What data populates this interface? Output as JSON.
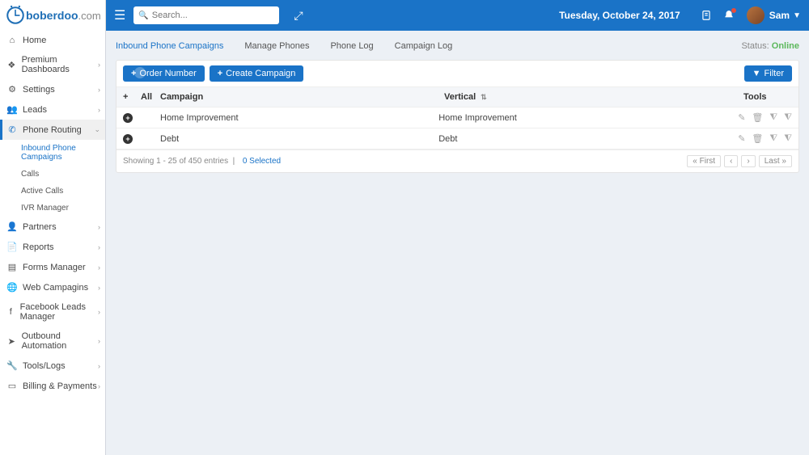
{
  "header": {
    "logo_main": "boberdoo",
    "logo_ext": ".com",
    "search_placeholder": "Search...",
    "date": "Tuesday, October 24, 2017",
    "user_name": "Sam"
  },
  "sidebar": {
    "items": [
      {
        "label": "Home",
        "icon": "home",
        "expandable": false
      },
      {
        "label": "Premium Dashboards",
        "icon": "dashboard",
        "expandable": true
      },
      {
        "label": "Settings",
        "icon": "gear",
        "expandable": true
      },
      {
        "label": "Leads",
        "icon": "users",
        "expandable": true
      },
      {
        "label": "Phone Routing",
        "icon": "phone",
        "expandable": true,
        "active": true
      },
      {
        "label": "Partners",
        "icon": "user",
        "expandable": true
      },
      {
        "label": "Reports",
        "icon": "file",
        "expandable": true
      },
      {
        "label": "Forms Manager",
        "icon": "form",
        "expandable": true
      },
      {
        "label": "Web Campagins",
        "icon": "globe",
        "expandable": true
      },
      {
        "label": "Facebook Leads Manager",
        "icon": "facebook",
        "expandable": true
      },
      {
        "label": "Outbound Automation",
        "icon": "send",
        "expandable": true
      },
      {
        "label": "Tools/Logs",
        "icon": "wrench",
        "expandable": true
      },
      {
        "label": "Billing & Payments",
        "icon": "card",
        "expandable": true
      }
    ],
    "phone_routing_sub": [
      {
        "label": "Inbound Phone Campaigns",
        "active": true
      },
      {
        "label": "Calls"
      },
      {
        "label": "Active Calls"
      },
      {
        "label": "IVR Manager"
      }
    ]
  },
  "tabs": {
    "items": [
      {
        "label": "Inbound Phone Campaigns",
        "active": true
      },
      {
        "label": "Manage Phones"
      },
      {
        "label": "Phone Log"
      },
      {
        "label": "Campaign Log"
      }
    ],
    "status_label": "Status:",
    "status_value": "Online"
  },
  "toolbar": {
    "order_number_label": "Order Number",
    "create_campaign_label": "Create Campaign",
    "filter_label": "Filter"
  },
  "table": {
    "headers": {
      "all": "All",
      "campaign": "Campaign",
      "vertical": "Vertical",
      "tools": "Tools"
    },
    "rows": [
      {
        "campaign": "Home Improvement",
        "vertical": "Home Improvement"
      },
      {
        "campaign": "Debt",
        "vertical": "Debt"
      }
    ],
    "footer_text": "Showing 1 - 25 of 450 entries",
    "selected_text": "0 Selected",
    "pager": {
      "first": "« First",
      "prev": "‹",
      "next": "›",
      "last": "Last »"
    }
  }
}
